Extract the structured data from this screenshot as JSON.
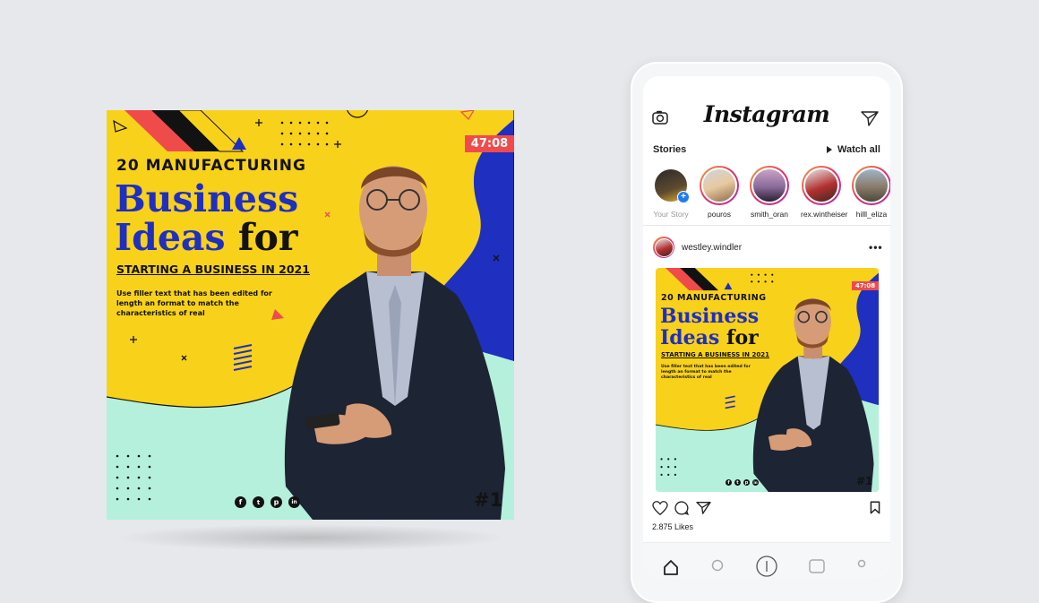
{
  "poster": {
    "top_label": "20 MANUFACTURING",
    "headline_line1": "Business",
    "headline_line2_a": "Ideas",
    "headline_line2_b": "for",
    "subheadline": "STARTING A BUSINESS IN 2021",
    "filler_text": "Use filler text that has been edited for length an format to match the characteristics of real",
    "timer": "47:08",
    "badge_number": "#1",
    "social_icons": [
      "facebook-icon",
      "twitter-icon",
      "pinterest-icon",
      "linkedin-icon"
    ]
  },
  "instagram": {
    "logo": "Instagram",
    "stories_label": "Stories",
    "watch_all_label": "Watch all",
    "stories": [
      {
        "name": "Your Story"
      },
      {
        "name": "pouros"
      },
      {
        "name": "smith_oran"
      },
      {
        "name": "rex.wintheiser"
      },
      {
        "name": "hilll_eliza"
      }
    ],
    "post": {
      "username": "westley.windler",
      "likes": "2.875 Likes"
    }
  },
  "colors": {
    "yellow": "#f8d11b",
    "blue": "#1f2fc0",
    "mint": "#b5f0dc",
    "red": "#f04b4b",
    "background": "#e6e8eb"
  }
}
